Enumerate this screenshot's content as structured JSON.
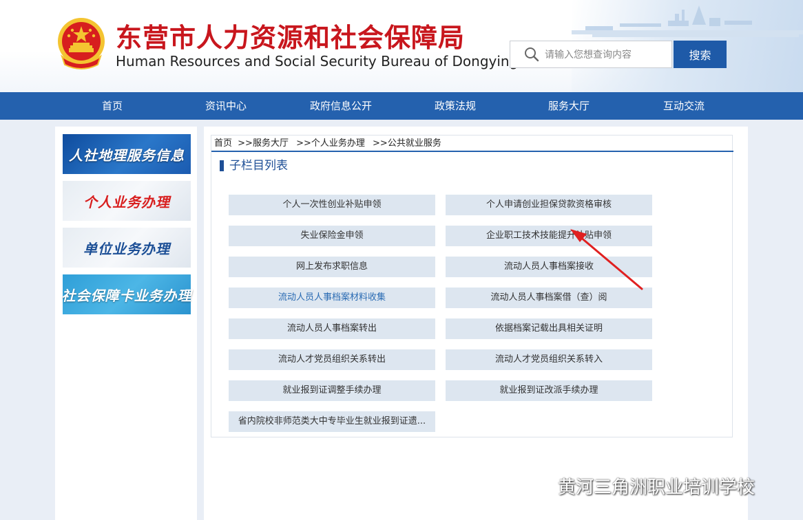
{
  "header": {
    "title": "东营市人力资源和社会保障局",
    "subtitle": "Human Resources and Social Security Bureau of Dongying",
    "logo_icon": "national-emblem-icon",
    "title_color": "#c8161d"
  },
  "search": {
    "placeholder": "请输入您想查询内容",
    "button_label": "搜索",
    "icon": "search-icon"
  },
  "nav": {
    "items": [
      "首页",
      "资讯中心",
      "政府信息公开",
      "政策法规",
      "服务大厅",
      "互动交流"
    ],
    "color": "#2461ae"
  },
  "sidebar": {
    "items": [
      "人社地理服务信息",
      "个人业务办理",
      "单位业务办理",
      "社会保障卡业务办理"
    ]
  },
  "breadcrumb": [
    "首页",
    ">>服务大厅",
    ">>个人业务办理",
    ">>公共就业服务"
  ],
  "section_title": "子栏目列表",
  "services": [
    "个人一次性创业补贴申领",
    "个人申请创业担保贷款资格审核",
    "失业保险金申领",
    "企业职工技术技能提升补贴申领",
    "网上发布求职信息",
    "流动人员人事档案接收",
    "流动人员人事档案材料收集",
    "流动人员人事档案借（查）阅",
    "流动人员人事档案转出",
    "依据档案记载出具相关证明",
    "流动人才党员组织关系转出",
    "流动人才党员组织关系转入",
    "就业报到证调整手续办理",
    "就业报到证改派手续办理",
    "省内院校非师范类大中专毕业生就业报到证遗..."
  ],
  "active_service_index": 6,
  "annotation_color": "#e02020",
  "watermark": {
    "text": "黄河三角洲职业培训学校",
    "icon": "wechat-icon"
  }
}
